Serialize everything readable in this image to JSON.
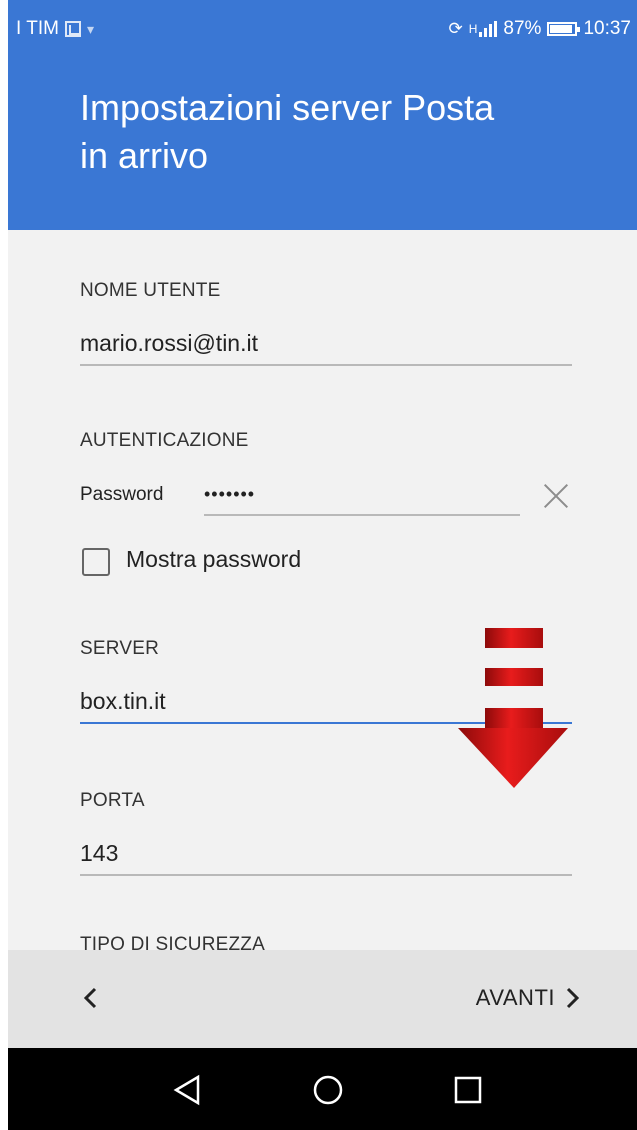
{
  "status_bar": {
    "carrier": "I TIM",
    "network_type": "H",
    "battery": "87%",
    "time": "10:37",
    "icons": [
      "sim-icon",
      "wifi-icon",
      "rotate-icon",
      "signal-icon",
      "battery-icon"
    ]
  },
  "app_bar": {
    "title_line1": "Impostazioni server Posta",
    "title_line2": "in arrivo"
  },
  "form": {
    "username": {
      "label": "NOME UTENTE",
      "value": "mario.rossi@tin.it"
    },
    "auth": {
      "label": "AUTENTICAZIONE",
      "password_label": "Password",
      "password_value": "•••••••",
      "clear_icon": "close-icon",
      "show_password_label": "Mostra password",
      "show_password_checked": false
    },
    "server": {
      "label": "SERVER",
      "value": "box.tin.it",
      "focused": true
    },
    "port": {
      "label": "PORTA",
      "value": "143"
    },
    "security": {
      "label": "TIPO DI SICUREZZA"
    }
  },
  "action_bar": {
    "back_icon": "chevron-left-icon",
    "next_label": "AVANTI",
    "next_icon": "chevron-right-icon"
  },
  "system_nav": {
    "icons": [
      "back-triangle-icon",
      "home-circle-icon",
      "recents-square-icon"
    ]
  },
  "colors": {
    "accent": "#3a77d4",
    "background": "#f2f2f2",
    "arrow_red": "#d41414"
  }
}
